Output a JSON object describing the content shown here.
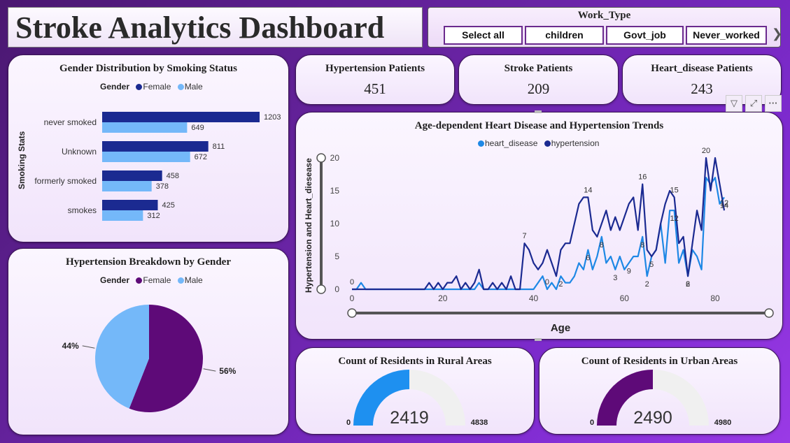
{
  "dashboard": {
    "title": "Stroke Analytics Dashboard"
  },
  "slicer": {
    "title": "Work_Type",
    "options": [
      "Select all",
      "children",
      "Govt_job",
      "Never_worked"
    ],
    "next_icon": "chevron-right-icon"
  },
  "kpis": [
    {
      "label": "Hypertension Patients",
      "value": "451"
    },
    {
      "label": "Stroke Patients",
      "value": "209"
    },
    {
      "label": "Heart_disease Patients",
      "value": "243"
    }
  ],
  "visual_toolbar": {
    "icons": [
      "filter-icon",
      "focus-mode-icon",
      "more-options-icon"
    ]
  },
  "colors": {
    "female": "#1b2a91",
    "male": "#74b8f9",
    "pie_female": "#5e0a78",
    "pie_male": "#74b8f9",
    "heart": "#1e88e5",
    "hyper": "#1b2a91",
    "gauge_rural": "#1e90f0",
    "gauge_urban": "#5e0a78",
    "gauge_track": "#f0f0f0"
  },
  "chart_data": [
    {
      "type": "bar",
      "title": "Gender Distribution by Smoking Status",
      "legend_title": "Gender",
      "ylabel": "Smoking Stats",
      "categories": [
        "never smoked",
        "Unknown",
        "formerly smoked",
        "smokes"
      ],
      "series": [
        {
          "name": "Female",
          "values": [
            1203,
            811,
            458,
            425
          ]
        },
        {
          "name": "Male",
          "values": [
            649,
            672,
            378,
            312
          ]
        }
      ]
    },
    {
      "type": "pie",
      "title": "Hypertension Breakdown by Gender",
      "legend_title": "Gender",
      "labels": [
        "Female",
        "Male"
      ],
      "values": [
        56,
        44
      ],
      "value_labels": [
        "56%",
        "44%"
      ]
    },
    {
      "type": "line",
      "title": "Age-dependent Heart Disease and Hypertension Trends",
      "xlabel": "Age",
      "ylabel": "Hypertension and Heart_diesease",
      "xlim": [
        0,
        82
      ],
      "ylim": [
        0,
        20
      ],
      "xticks": [
        0,
        20,
        40,
        60,
        80
      ],
      "yticks": [
        0,
        5,
        10,
        15,
        20
      ],
      "series": [
        {
          "name": "heart_disease",
          "x": [
            0,
            1,
            2,
            3,
            4,
            5,
            6,
            7,
            8,
            9,
            10,
            11,
            12,
            13,
            14,
            15,
            16,
            17,
            18,
            19,
            20,
            21,
            22,
            23,
            24,
            25,
            26,
            27,
            28,
            29,
            30,
            31,
            32,
            33,
            34,
            35,
            36,
            37,
            38,
            39,
            40,
            41,
            42,
            43,
            44,
            45,
            46,
            47,
            48,
            49,
            50,
            51,
            52,
            53,
            54,
            55,
            56,
            57,
            58,
            59,
            60,
            61,
            62,
            63,
            64,
            65,
            66,
            67,
            68,
            69,
            70,
            71,
            72,
            73,
            74,
            75,
            76,
            77,
            78,
            79,
            80,
            81,
            82
          ],
          "values": [
            0,
            0,
            1,
            0,
            0,
            0,
            0,
            0,
            0,
            0,
            0,
            0,
            0,
            0,
            0,
            0,
            0,
            0,
            0,
            0,
            0,
            0,
            0,
            0,
            0,
            0,
            0,
            0,
            1,
            0,
            0,
            0,
            0,
            0,
            0,
            0,
            0,
            0,
            0,
            0,
            0,
            1,
            2,
            0,
            1,
            0,
            2,
            1,
            1,
            2,
            4,
            3,
            6,
            3,
            5,
            8,
            4,
            5,
            3,
            5,
            3,
            4,
            5,
            5,
            8,
            2,
            5,
            6,
            10,
            4,
            12,
            12,
            4,
            6,
            2,
            6,
            5,
            3,
            17,
            16,
            17,
            13,
            14
          ]
        },
        {
          "name": "hypertension",
          "x": [
            0,
            1,
            2,
            3,
            4,
            5,
            6,
            7,
            8,
            9,
            10,
            11,
            12,
            13,
            14,
            15,
            16,
            17,
            18,
            19,
            20,
            21,
            22,
            23,
            24,
            25,
            26,
            27,
            28,
            29,
            30,
            31,
            32,
            33,
            34,
            35,
            36,
            37,
            38,
            39,
            40,
            41,
            42,
            43,
            44,
            45,
            46,
            47,
            48,
            49,
            50,
            51,
            52,
            53,
            54,
            55,
            56,
            57,
            58,
            59,
            60,
            61,
            62,
            63,
            64,
            65,
            66,
            67,
            68,
            69,
            70,
            71,
            72,
            73,
            74,
            75,
            76,
            77,
            78,
            79,
            80,
            81,
            82
          ],
          "values": [
            0,
            0,
            0,
            0,
            0,
            0,
            0,
            0,
            0,
            0,
            0,
            0,
            0,
            0,
            0,
            0,
            0,
            1,
            0,
            1,
            0,
            1,
            1,
            2,
            0,
            1,
            0,
            1,
            3,
            0,
            0,
            1,
            0,
            1,
            0,
            2,
            0,
            0,
            7,
            6,
            4,
            3,
            4,
            6,
            4,
            2,
            6,
            7,
            7,
            10,
            13,
            14,
            14,
            9,
            8,
            10,
            12,
            9,
            11,
            9,
            11,
            13,
            14,
            9,
            16,
            6,
            5,
            6,
            10,
            13,
            15,
            14,
            7,
            8,
            2,
            7,
            12,
            9,
            20,
            15,
            20,
            16,
            12
          ]
        }
      ],
      "data_labels": [
        {
          "series": "heart_disease",
          "x": 0,
          "text": "0"
        },
        {
          "series": "hypertension",
          "x": 38,
          "text": "7"
        },
        {
          "series": "heart_disease",
          "x": 43,
          "text": "0"
        },
        {
          "series": "heart_disease",
          "x": 46,
          "text": "2"
        },
        {
          "series": "hypertension",
          "x": 52,
          "text": "14"
        },
        {
          "series": "heart_disease",
          "x": 52,
          "text": "6"
        },
        {
          "series": "heart_disease",
          "x": 55,
          "text": "8"
        },
        {
          "series": "heart_disease",
          "x": 58,
          "text": "3"
        },
        {
          "series": "heart_disease",
          "x": 61,
          "text": "9"
        },
        {
          "series": "hypertension",
          "x": 64,
          "text": "16"
        },
        {
          "series": "heart_disease",
          "x": 64,
          "text": "8"
        },
        {
          "series": "heart_disease",
          "x": 65,
          "text": "2"
        },
        {
          "series": "heart_disease",
          "x": 66,
          "text": "5"
        },
        {
          "series": "hypertension",
          "x": 71,
          "text": "15"
        },
        {
          "series": "heart_disease",
          "x": 71,
          "text": "12"
        },
        {
          "series": "heart_disease",
          "x": 74,
          "text": "6"
        },
        {
          "series": "heart_disease",
          "x": 74,
          "text": "2"
        },
        {
          "series": "hypertension",
          "x": 78,
          "text": "20"
        },
        {
          "series": "heart_disease",
          "x": 82,
          "text": "14"
        },
        {
          "series": "hypertension",
          "x": 82,
          "text": "12"
        }
      ]
    }
  ],
  "gauges": [
    {
      "title": "Count of Residents in Rural Areas",
      "value": 2419,
      "value_label": "2419",
      "min_label": "0",
      "max": 4838,
      "max_label": "4838",
      "color_key": "gauge_rural"
    },
    {
      "title": "Count of Residents in Urban Areas",
      "value": 2490,
      "value_label": "2490",
      "min_label": "0",
      "max": 4980,
      "max_label": "4980",
      "color_key": "gauge_urban"
    }
  ]
}
